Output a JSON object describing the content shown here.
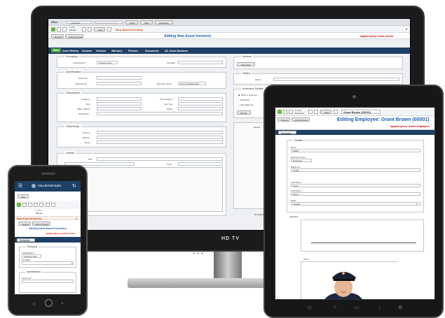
{
  "monitor": {
    "brand": "HD TV",
    "filter_bar": {
      "label": "Filter:",
      "select_value": "-- Standard --",
      "search_placeholder": "Enter text here to filter",
      "apply": "Apply",
      "filter": "Filter",
      "advanced": "Advanced"
    },
    "record_toolbar": {
      "record_of": "1 of 10",
      "record_label": "Barcode",
      "save": "Save",
      "title_right": "New Asset Inventory"
    },
    "header": {
      "reports": "Reports",
      "activity_report": "Activity Report",
      "heading": "Adding New Asset Inventory",
      "applied_query": "Applied Query: Active Assets"
    },
    "tabs": [
      "Main",
      "Asset History",
      "Sockets",
      "Vendors",
      "Warranty",
      "Pictures",
      "Documents",
      "Alt. Asset Numbers"
    ],
    "sections": {
      "grouping": {
        "title": "Grouping",
        "classification_label": "Classification*",
        "classification_value": "Inventory Item",
        "template_label": "Template"
      },
      "identification": {
        "title": "Identification",
        "asset_no": "Asset No *",
        "barcode_no": "Barcode No",
        "barcode_labels": "Barcode Labels",
        "barcode_labels_value": "Don't print Barcodes"
      },
      "description": {
        "title": "Description",
        "left": [
          "Category",
          "Type",
          "Make / Brand",
          "Description"
        ],
        "right": [
          "Sub Category",
          "Sub Type",
          "Model"
        ]
      },
      "ownership": {
        "title": "Ownership",
        "fields": [
          "Division",
          "Section",
          "Vessel"
        ]
      },
      "details": {
        "title": "Details",
        "size": "Size",
        "color": "Color"
      },
      "actions": {
        "title": "Actions",
        "issue_item": "Issue Item"
      },
      "status": {
        "title": "Status",
        "status_label": "Status"
      },
      "inventory": {
        "title": "Inventory Details",
        "options": [
          "Track in Inventory",
          "Serialized",
          "Has Shelf Life"
        ],
        "qty_btn": "Add Qty"
      },
      "picture_label": "Picture",
      "notes_label": "Description / Location"
    }
  },
  "tablet": {
    "record_of": "1 of 10",
    "record_label": "Employee",
    "save": "Save",
    "title_box": "Grant Brown (00001)",
    "reports": "Reports",
    "activity_report": "Activity Report",
    "heading": "Editing Employee: Grant Brown (00001)",
    "applied_query": "Applied Query: Active Employees",
    "navigation": "Navigation",
    "details": "Details",
    "fields": [
      {
        "label": "ID No",
        "value": "00001"
      },
      {
        "label": "Employee Type",
        "value": "Employee"
      },
      {
        "label": "Badge No",
        "value": "12345"
      },
      {
        "label": "First Name",
        "value": "Grant"
      },
      {
        "label": "Last Name",
        "value": "Brown"
      },
      {
        "label": "Rank",
        "value": "Captain"
      }
    ],
    "signature": "Signature",
    "photo": "Photo"
  },
  "phone": {
    "brand": "COLLECTIVE DATA",
    "filter": "Filter",
    "record_of": "1 of 10",
    "record_label": "Barcode",
    "title_bar": "New Asset Inventory",
    "reports": "Reports",
    "activity_report": "Activity Report",
    "heading": "Adding New Asset Inventory",
    "applied_query": "Applied Query: Active Assets",
    "navigation": "Navigation",
    "grouping": "Grouping",
    "classification": "Classification *",
    "classification_value": "Inventory Item",
    "template": "Template",
    "identification": "Identification",
    "asset_no": "Asset No *"
  }
}
